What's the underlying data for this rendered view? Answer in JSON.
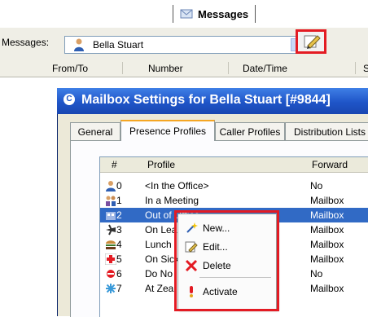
{
  "top_tab": {
    "label": "Messages"
  },
  "messages_bar": {
    "label": "Messages:",
    "selected_user": "Bella Stuart"
  },
  "list_header": {
    "columns": [
      "From/To",
      "Number",
      "Date/Time",
      "S"
    ]
  },
  "dialog": {
    "title": "Mailbox Settings for Bella Stuart [#9844]",
    "tabs": [
      "General",
      "Presence Profiles",
      "Caller Profiles",
      "Distribution Lists"
    ],
    "active_tab": "Presence Profiles",
    "grid": {
      "columns": [
        "#",
        "Profile",
        "Forward"
      ],
      "rows": [
        {
          "num": "0",
          "profile": "<In the Office>",
          "forward": "No",
          "icon": "person-icon"
        },
        {
          "num": "1",
          "profile": "In a Meeting",
          "forward": "Mailbox",
          "icon": "meeting-icon"
        },
        {
          "num": "2",
          "profile": "Out of Office",
          "forward": "Mailbox",
          "icon": "office-icon",
          "selected": true
        },
        {
          "num": "3",
          "profile": "On Lea",
          "forward": "Mailbox",
          "icon": "plane-icon"
        },
        {
          "num": "4",
          "profile": "Lunch",
          "forward": "Mailbox",
          "icon": "burger-icon"
        },
        {
          "num": "5",
          "profile": "On Sick",
          "forward": "Mailbox",
          "icon": "medical-cross-icon"
        },
        {
          "num": "6",
          "profile": "Do No",
          "forward": "No",
          "icon": "do-not-disturb-icon"
        },
        {
          "num": "7",
          "profile": "At Zea",
          "forward": "Mailbox",
          "icon": "snowflake-icon"
        }
      ]
    }
  },
  "context_menu": {
    "items": [
      {
        "label": "New...",
        "icon": "new-sparkle-icon"
      },
      {
        "label": "Edit...",
        "icon": "edit-pencil-icon"
      },
      {
        "label": "Delete",
        "icon": "delete-x-icon"
      },
      {
        "label": "Activate",
        "icon": "exclamation-icon"
      }
    ]
  },
  "colors": {
    "selection": "#316ac5",
    "title_bar": "#1f55c8",
    "highlight_box": "#e31b23"
  }
}
